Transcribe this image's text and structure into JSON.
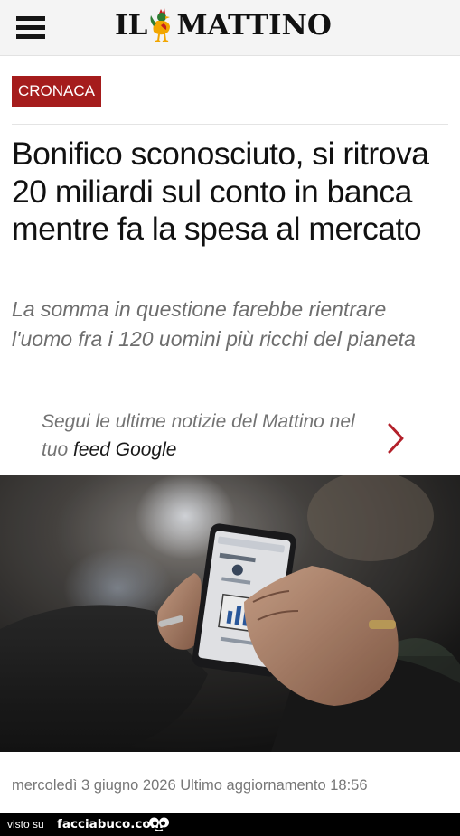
{
  "header": {
    "logo_left": "IL",
    "logo_right": "MATTINO",
    "menu_icon": "hamburger-menu-icon",
    "logo_icon": "rooster-icon"
  },
  "article": {
    "section": "CRONACA",
    "headline": "Bonifico sconosciuto, si ritrova 20 miliardi sul conto in banca mentre fa la spesa al mercato",
    "subtitle": "La somma in questione farebbe rientrare l'uomo fra i 120 uomini più ricchi del pianeta",
    "dateline": "mercoledì 3 giugno 2026 Ultimo aggiornamento 18:56"
  },
  "feed_promo": {
    "text_part1": "Segui le ultime notizie del Mattino nel tuo ",
    "text_emphasis": "feed Google",
    "icon": "chevron-right-icon"
  },
  "watermark": {
    "prefix": "visto su",
    "brand": "facciabuco.com",
    "icon": "eyes-icon"
  },
  "colors": {
    "section_badge": "#a51c1c",
    "headline": "#111111",
    "subtitle": "#6e6e6e",
    "chevron": "#b3202a"
  }
}
